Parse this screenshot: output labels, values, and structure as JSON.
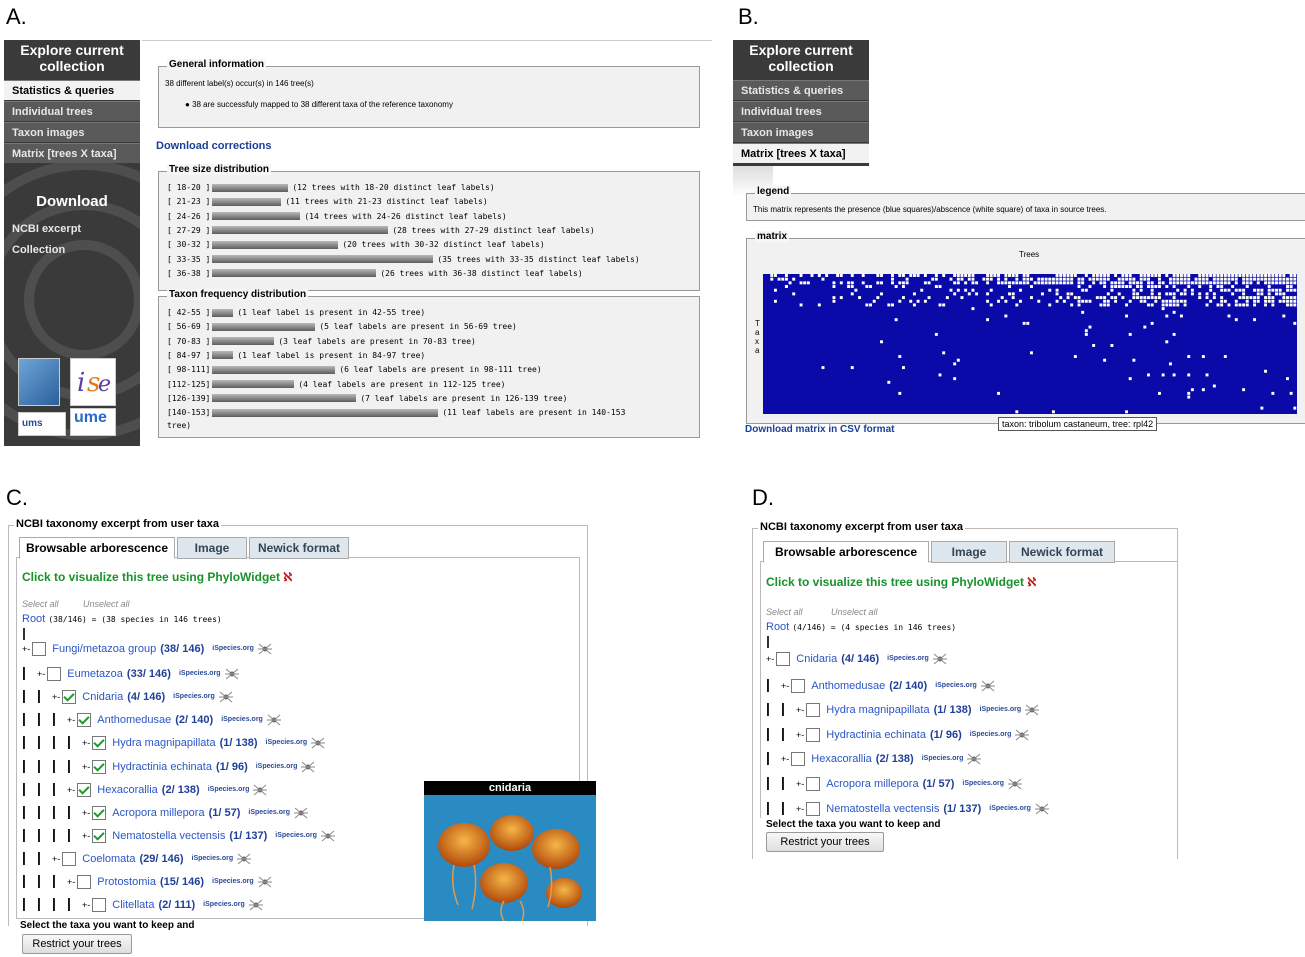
{
  "panel_labels": {
    "a": "A.",
    "b": "B.",
    "c": "C.",
    "d": "D."
  },
  "sidebar": {
    "title_line1": "Explore current",
    "title_line2": "collection",
    "items": [
      "Statistics & queries",
      "Individual trees",
      "Taxon images",
      "Matrix [trees X taxa]"
    ],
    "download_title": "Download",
    "download_items": [
      "NCBI excerpt",
      "Collection"
    ],
    "logo_labels": [
      "ums",
      "ume"
    ]
  },
  "panel_a": {
    "general": {
      "legend": "General information",
      "line1": "38 different label(s) occur(s) in 146 tree(s)",
      "bullet": "38 are successfuly mapped to 38 different taxa of the reference taxonomy"
    },
    "download_corrections": "Download corrections",
    "tree_size": {
      "legend": "Tree size distribution",
      "rows": [
        {
          "range": "[ 18-20 ]",
          "value": 12,
          "label": "(12 trees with 18-20 distinct leaf labels)"
        },
        {
          "range": "[ 21-23 ]",
          "value": 11,
          "label": "(11 trees with 21-23 distinct leaf labels)"
        },
        {
          "range": "[ 24-26 ]",
          "value": 14,
          "label": "(14 trees with 24-26 distinct leaf labels)"
        },
        {
          "range": "[ 27-29 ]",
          "value": 28,
          "label": "(28 trees with 27-29 distinct leaf labels)"
        },
        {
          "range": "[ 30-32 ]",
          "value": 20,
          "label": "(20 trees with 30-32 distinct leaf labels)"
        },
        {
          "range": "[ 33-35 ]",
          "value": 35,
          "label": "(35 trees with 33-35 distinct leaf labels)"
        },
        {
          "range": "[ 36-38 ]",
          "value": 26,
          "label": "(26 trees with 36-38 distinct leaf labels)"
        }
      ]
    },
    "taxon_freq": {
      "legend": "Taxon frequency distribution",
      "rows": [
        {
          "range": "[ 42-55 ]",
          "value": 1,
          "label": "(1 leaf label is present in 42-55 tree)"
        },
        {
          "range": "[ 56-69 ]",
          "value": 5,
          "label": "(5 leaf labels are present in 56-69 tree)"
        },
        {
          "range": "[ 70-83 ]",
          "value": 3,
          "label": "(3 leaf labels are present in 70-83 tree)"
        },
        {
          "range": "[ 84-97 ]",
          "value": 1,
          "label": "(1 leaf label is present in 84-97 tree)"
        },
        {
          "range": "[ 98-111]",
          "value": 6,
          "label": "(6 leaf labels are present in 98-111 tree)"
        },
        {
          "range": "[112-125]",
          "value": 4,
          "label": "(4 leaf labels are present in 112-125 tree)"
        },
        {
          "range": "[126-139]",
          "value": 7,
          "label": "(7 leaf labels are present in 126-139 tree)"
        },
        {
          "range": "[140-153]",
          "value": 11,
          "label": "(11 leaf labels are present in 140-153"
        }
      ],
      "wrap_tail": "tree)"
    }
  },
  "panel_b": {
    "legend_title": "legend",
    "legend_text": "This matrix represents the presence (blue squares)/abscence (white square) of taxa in source trees.",
    "matrix_title": "matrix",
    "x_axis": "Trees",
    "y_axis": [
      "T",
      "a",
      "x",
      "a"
    ],
    "download": "Download matrix in CSV format",
    "tooltip": "taxon: tribolum castaneum, tree: rpl42",
    "colors": {
      "present": "#0a0aa8",
      "absent": "#ffffff"
    }
  },
  "panel_c": {
    "box_title": "NCBI taxonomy excerpt from user taxa",
    "tabs": [
      "Browsable arborescence",
      "Image",
      "Newick format"
    ],
    "visualize": "Click to visualize this tree using PhyloWidget",
    "select_all": "Select all",
    "unselect_all": "Unselect all",
    "root_link": "Root",
    "root_info": "(38/146) = (38 species in 146 trees)",
    "rows": [
      {
        "prefix": "+-",
        "name": "Fungi/metazoa group",
        "count": "(38/ 146)",
        "checked": false
      },
      {
        "prefix": "| +-",
        "name": "Eumetazoa",
        "count": "(33/ 146)",
        "checked": false
      },
      {
        "prefix": "| | +-",
        "name": "Cnidaria",
        "count": "(4/ 146)",
        "checked": true
      },
      {
        "prefix": "| | | +-",
        "name": "Anthomedusae",
        "count": "(2/ 140)",
        "checked": true
      },
      {
        "prefix": "| | | | +-",
        "name": "Hydra magnipapillata",
        "count": "(1/ 138)",
        "checked": true
      },
      {
        "prefix": "| | | | +-",
        "name": "Hydractinia echinata",
        "count": "(1/ 96)",
        "checked": true
      },
      {
        "prefix": "| | | +-",
        "name": "Hexacorallia",
        "count": "(2/ 138)",
        "checked": true
      },
      {
        "prefix": "| | | | +-",
        "name": "Acropora millepora",
        "count": "(1/ 57)",
        "checked": true
      },
      {
        "prefix": "| | | | +-",
        "name": "Nematostella vectensis",
        "count": "(1/ 137)",
        "checked": true
      },
      {
        "prefix": "| | +-",
        "name": "Coelomata",
        "count": "(29/ 146)",
        "checked": false
      },
      {
        "prefix": "| | | +-",
        "name": "Protostomia",
        "count": "(15/ 146)",
        "checked": false
      },
      {
        "prefix": "| | | | +-",
        "name": "Clitellata",
        "count": "(2/ 111)",
        "checked": false
      }
    ],
    "ispecies": "iSpecies.org",
    "image_caption": "cnidaria",
    "select_keep": "Select the taxa you want to keep and",
    "restrict_button": "Restrict your trees"
  },
  "panel_d": {
    "box_title": "NCBI taxonomy excerpt from user taxa",
    "tabs": [
      "Browsable arborescence",
      "Image",
      "Newick format"
    ],
    "visualize": "Click to visualize this tree using PhyloWidget",
    "select_all": "Select all",
    "unselect_all": "Unselect all",
    "root_link": "Root",
    "root_info": "(4/146) = (4 species in 146 trees)",
    "rows": [
      {
        "prefix": "+-",
        "name": "Cnidaria",
        "count": "(4/ 146)",
        "checked": false
      },
      {
        "prefix": "| +-",
        "name": "Anthomedusae",
        "count": "(2/ 140)",
        "checked": false
      },
      {
        "prefix": "| | +-",
        "name": "Hydra magnipapillata",
        "count": "(1/ 138)",
        "checked": false
      },
      {
        "prefix": "| | +-",
        "name": "Hydractinia echinata",
        "count": "(1/ 96)",
        "checked": false
      },
      {
        "prefix": "| +-",
        "name": "Hexacorallia",
        "count": "(2/ 138)",
        "checked": false
      },
      {
        "prefix": "| | +-",
        "name": "Acropora millepora",
        "count": "(1/ 57)",
        "checked": false
      },
      {
        "prefix": "| | +-",
        "name": "Nematostella vectensis",
        "count": "(1/ 137)",
        "checked": false
      }
    ],
    "ispecies": "iSpecies.org",
    "select_keep": "Select the taxa you want to keep and",
    "restrict_button": "Restrict your trees"
  }
}
